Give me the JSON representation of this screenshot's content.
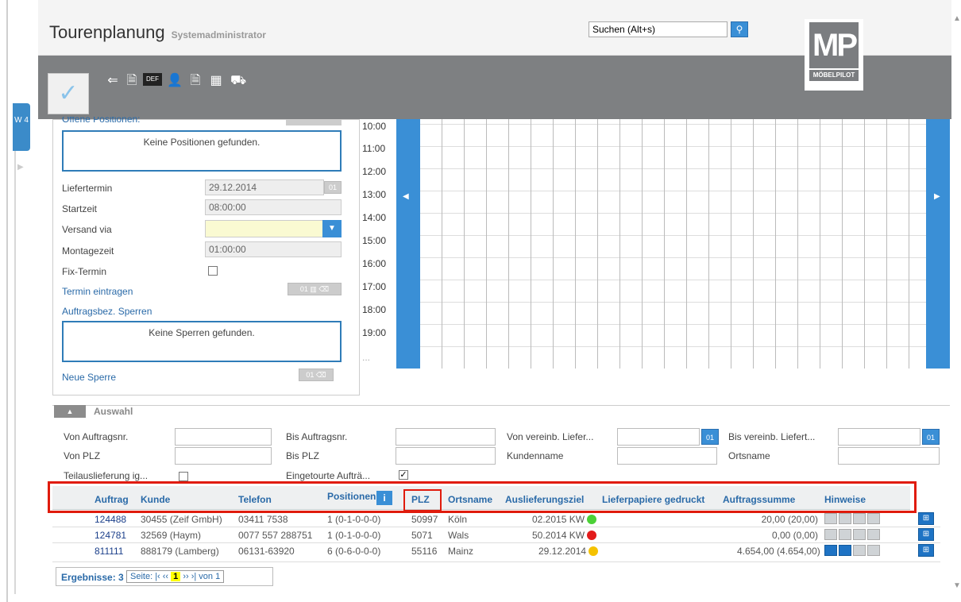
{
  "header": {
    "title": "Tourenplanung",
    "subtitle": "Systemadministrator",
    "search_placeholder": "Suchen (Alt+s)",
    "logo_text": "MP",
    "logo_brand": "MÖBELPILOT"
  },
  "side_tab": {
    "label": "W 4"
  },
  "left_panel": {
    "offene_title": "Offene Positionen:",
    "no_positions": "Keine Positionen gefunden.",
    "liefertermin_label": "Liefertermin",
    "liefertermin_value": "29.12.2014",
    "startzeit_label": "Startzeit",
    "startzeit_value": "08:00:00",
    "versand_label": "Versand via",
    "versand_value": "",
    "montagezeit_label": "Montagezeit",
    "montagezeit_value": "01:00:00",
    "fix_label": "Fix-Termin",
    "termin_link": "Termin eintragen",
    "sperren_link": "Auftragsbez. Sperren",
    "no_sperren": "Keine Sperren gefunden.",
    "neue_sperre": "Neue Sperre"
  },
  "times": [
    "10:00",
    "11:00",
    "12:00",
    "13:00",
    "14:00",
    "15:00",
    "16:00",
    "17:00",
    "18:00",
    "19:00",
    "..."
  ],
  "auswahl": {
    "title": "Auswahl",
    "von_auftrag": "Von Auftragsnr.",
    "bis_auftrag": "Bis Auftragsnr.",
    "von_liefer": "Von vereinb. Liefer...",
    "bis_liefer": "Bis vereinb. Liefert...",
    "von_plz": "Von PLZ",
    "bis_plz": "Bis PLZ",
    "kundenname": "Kundenname",
    "ortsname": "Ortsname",
    "teil": "Teilauslieferung ig...",
    "eingetourt": "Eingetourte Aufträ..."
  },
  "table": {
    "headers": {
      "auftrag": "Auftrag",
      "kunde": "Kunde",
      "telefon": "Telefon",
      "positionen": "Positionen",
      "plz": "PLZ",
      "ortsname": "Ortsname",
      "ausliefer": "Auslieferungsziel",
      "papiere": "Lieferpapiere gedruckt",
      "summe": "Auftragssumme",
      "hinweise": "Hinweise"
    },
    "rows": [
      {
        "auftrag": "124488",
        "kunde": "30455 (Zeif GmbH)",
        "telefon": "03411 7538",
        "positionen": "1 (0-1-0-0-0)",
        "plz": "50997",
        "ort": "Köln",
        "ziel": "02.2015 KW",
        "summe": "20,00 (20,00)"
      },
      {
        "auftrag": "124781",
        "kunde": "32569 (Haym)",
        "telefon": "0077 557 288751",
        "positionen": "1 (0-1-0-0-0)",
        "plz": "5071",
        "ort": "Wals",
        "ziel": "50.2014 KW",
        "summe": "0,00 (0,00)"
      },
      {
        "auftrag": "811111",
        "kunde": "888179 (Lamberg)",
        "telefon": "06131-63920",
        "positionen": "6 (0-6-0-0-0)",
        "plz": "55116",
        "ort": "Mainz",
        "ziel": "29.12.2014",
        "summe": "4.654,00 (4.654,00)"
      }
    ]
  },
  "pager": {
    "ergebnisse": "Ergebnisse: 3",
    "seite": "Seite:",
    "current": "1",
    "von": "von 1"
  },
  "colors": {
    "green": "#4cd137",
    "red": "#e21b1b",
    "yellow": "#f5c200",
    "accent": "#3a8fd6"
  }
}
